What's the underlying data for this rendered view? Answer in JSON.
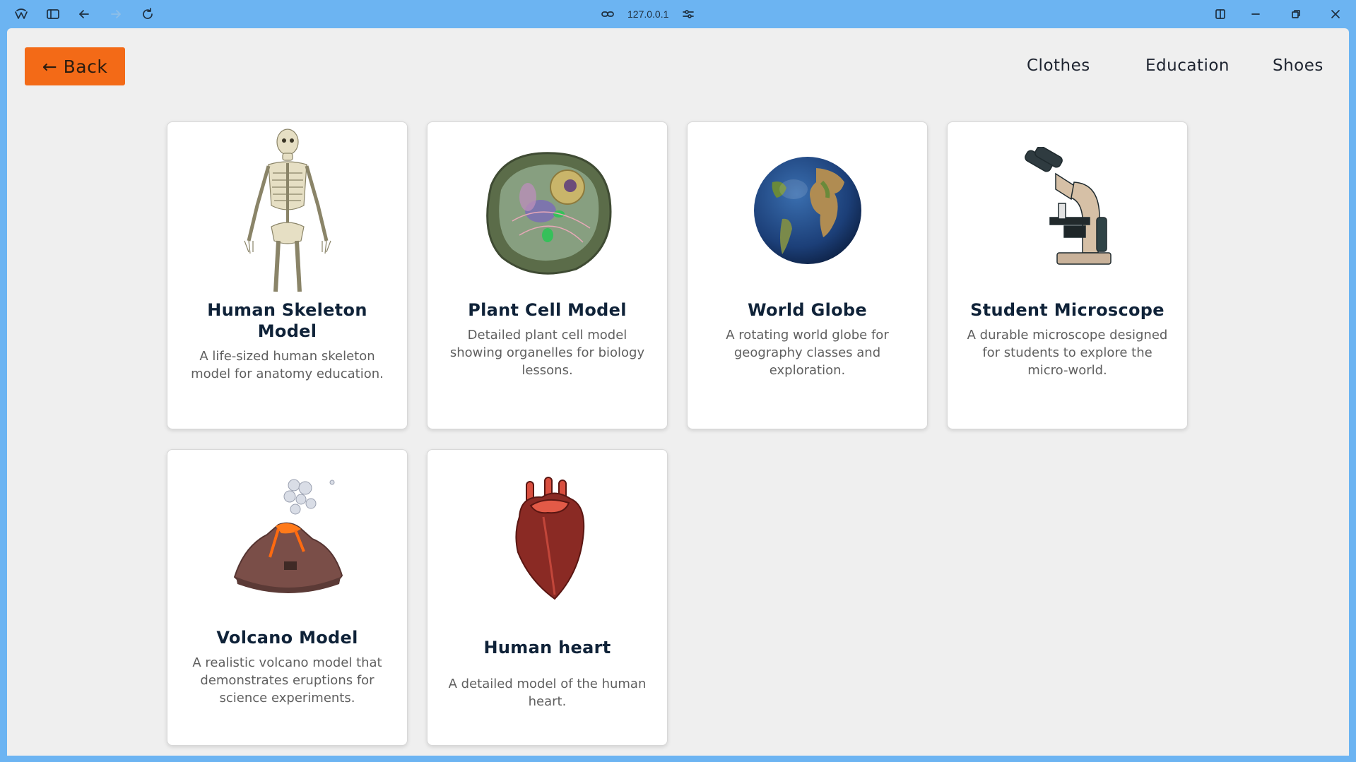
{
  "browser": {
    "url": "127.0.0.1",
    "icons": [
      "app-logo-icon",
      "sidebar-toggle-icon",
      "back-arrow-icon",
      "forward-arrow-icon",
      "reload-icon",
      "link-icon",
      "site-settings-icon",
      "split-view-icon",
      "minimize-icon",
      "restore-icon",
      "close-icon"
    ]
  },
  "header": {
    "back_label": "← Back",
    "nav": [
      "Clothes",
      "Education",
      "Shoes"
    ]
  },
  "products": [
    {
      "title": "Human Skeleton Model",
      "description": "A life-sized human skeleton model for anatomy education.",
      "icon": "skeleton-image"
    },
    {
      "title": "Plant Cell Model",
      "description": "Detailed plant cell model showing organelles for biology lessons.",
      "icon": "plant-cell-image"
    },
    {
      "title": "World Globe",
      "description": "A rotating world globe for geography classes and exploration.",
      "icon": "globe-image"
    },
    {
      "title": "Student Microscope",
      "description": "A durable microscope designed for students to explore the micro-world.",
      "icon": "microscope-image"
    },
    {
      "title": "Volcano Model",
      "description": "A realistic volcano model that demonstrates eruptions for science experiments.",
      "icon": "volcano-image"
    },
    {
      "title": "Human heart",
      "description": "A detailed model of the human heart.",
      "icon": "heart-image"
    }
  ],
  "colors": {
    "chrome": "#6cb4f2",
    "page_background": "#efefef",
    "back_button": "#f36a17",
    "card_title": "#0f2238",
    "card_text": "#5f5f5f"
  }
}
